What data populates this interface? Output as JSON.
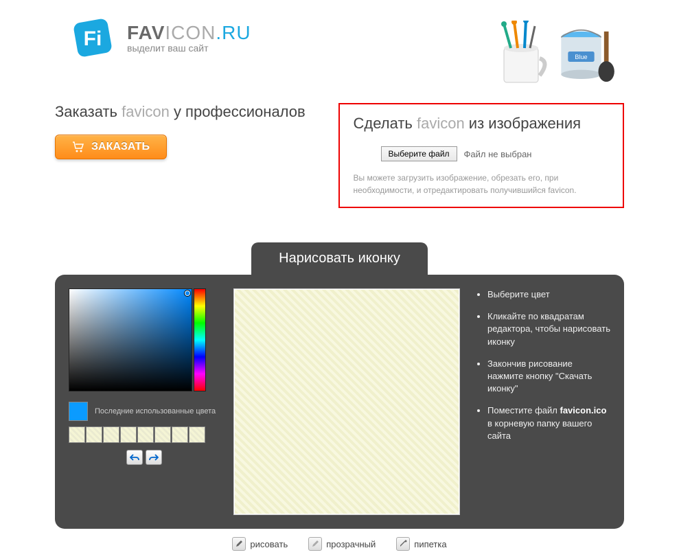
{
  "brand": {
    "part1": "FAV",
    "part2": "ICON",
    "part3": ".RU",
    "tagline": "выделит ваш сайт"
  },
  "left_section": {
    "title_prefix": "Заказать ",
    "title_hl": "favicon",
    "title_suffix": " у профессионалов",
    "order_button": "ЗАКАЗАТЬ"
  },
  "right_section": {
    "title_prefix": "Сделать ",
    "title_hl": "favicon",
    "title_suffix": " из изображения",
    "file_button": "Выберите файл",
    "file_status": "Файл не выбран",
    "hint": "Вы можете загрузить изображение, обрезать его, при необходимости, и отредактировать получившийся favicon."
  },
  "editor": {
    "title": "Нарисовать иконку",
    "recent_label": "Последние использованные цвета",
    "current_color": "#0b9bff",
    "instructions": [
      "Выберите цвет",
      "Кликайте по квадратам редактора, чтобы нарисовать иконку",
      "Закончив рисование нажмите кнопку \"Скачать иконку\"",
      "Поместите файл favicon.ico в корневую папку вашего сайта"
    ],
    "bold_fragment": "favicon.ico"
  },
  "tools": {
    "draw": "рисовать",
    "transparent": "прозрачный",
    "eyedropper": "пипетка"
  },
  "paint_label": "Blue"
}
